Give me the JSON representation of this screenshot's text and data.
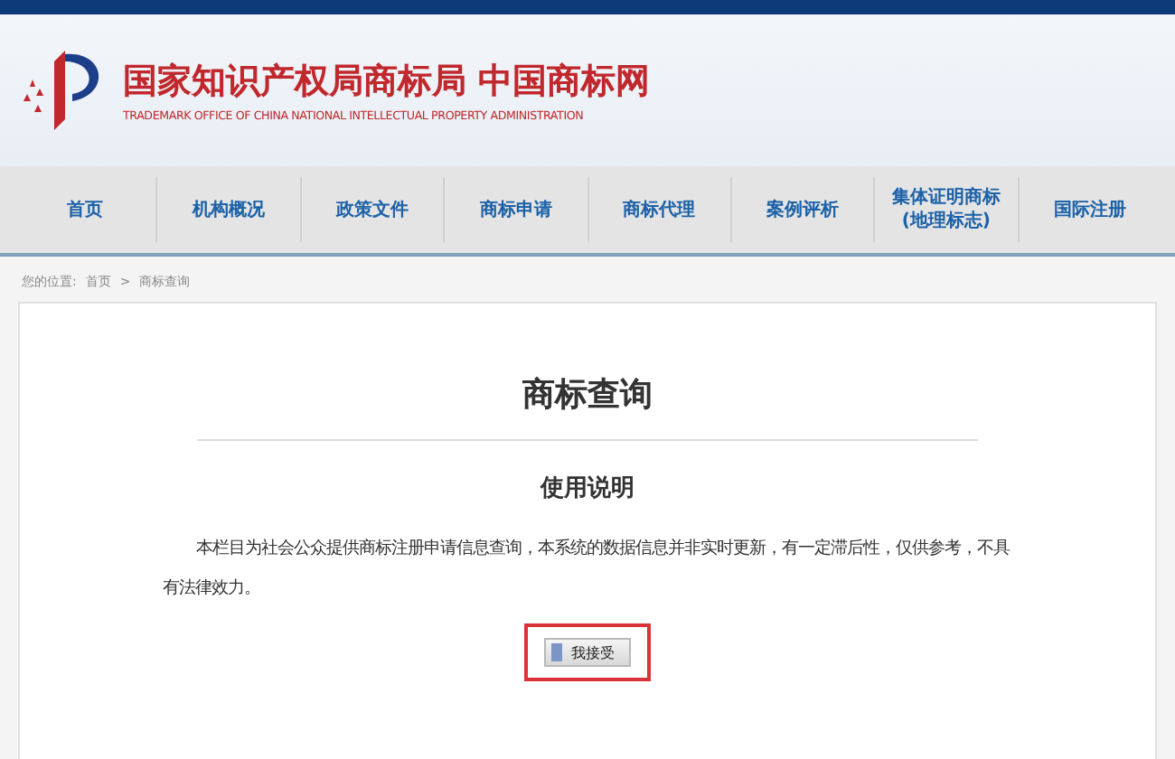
{
  "header": {
    "title": "国家知识产权局商标局 中国商标网",
    "subtitle": "TRADEMARK OFFICE OF CHINA NATIONAL INTELLECTUAL PROPERTY ADMINISTRATION"
  },
  "nav": [
    {
      "label": "首页"
    },
    {
      "label": "机构概况"
    },
    {
      "label": "政策文件"
    },
    {
      "label": "商标申请"
    },
    {
      "label": "商标代理"
    },
    {
      "label": "案例评析"
    },
    {
      "label": "集体证明商标\n(地理标志)"
    },
    {
      "label": "国际注册"
    }
  ],
  "breadcrumb": {
    "prefix": "您的位置:",
    "items": [
      "首页",
      "商标查询"
    ],
    "separator": ">"
  },
  "content": {
    "title": "商标查询",
    "subtitle": "使用说明",
    "text": "本栏目为社会公众提供商标注册申请信息查询，本系统的数据信息并非实时更新，有一定滞后性，仅供参考，不具有法律效力。",
    "button": "我接受"
  }
}
